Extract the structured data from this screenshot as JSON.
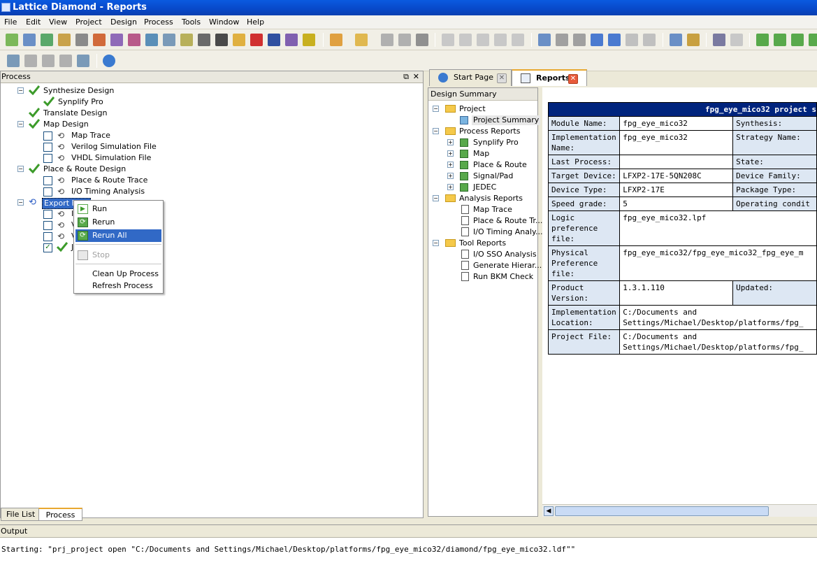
{
  "window": {
    "title": "Lattice Diamond - Reports"
  },
  "menu": [
    "File",
    "Edit",
    "View",
    "Project",
    "Design",
    "Process",
    "Tools",
    "Window",
    "Help"
  ],
  "process_panel": {
    "title": "Process",
    "items": [
      {
        "label": "Synthesize Design"
      },
      {
        "label": "Synplify Pro"
      },
      {
        "label": "Translate Design"
      },
      {
        "label": "Map Design"
      },
      {
        "label": "Map Trace"
      },
      {
        "label": "Verilog Simulation File"
      },
      {
        "label": "VHDL Simulation File"
      },
      {
        "label": "Place & Route Design"
      },
      {
        "label": "Place & Route Trace"
      },
      {
        "label": "I/O Timing Analysis"
      },
      {
        "label": "Export Files"
      },
      {
        "label": "I"
      },
      {
        "label": "V"
      },
      {
        "label": "V"
      },
      {
        "label": "J"
      }
    ]
  },
  "context_menu": {
    "run": "Run",
    "rerun": "Rerun",
    "rerun_all": "Rerun All",
    "stop": "Stop",
    "cleanup": "Clean Up Process",
    "refresh": "Refresh Process"
  },
  "bottom_tabs": {
    "file_list": "File List",
    "process": "Process"
  },
  "tabs": {
    "start_page": "Start Page",
    "reports": "Reports"
  },
  "design_summary": {
    "title": "Design Summary",
    "nodes": [
      "Project",
      "Project Summary",
      "Process Reports",
      "Synplify Pro",
      "Map",
      "Place & Route",
      "Signal/Pad",
      "JEDEC",
      "Analysis Reports",
      "Map Trace",
      "Place & Route Tr...",
      "I/O Timing Analy...",
      "Tool Reports",
      "I/O SSO Analysis",
      "Generate Hierar...",
      "Run BKM Check"
    ]
  },
  "report": {
    "header": "fpg_eye_mico32 project s",
    "rows": [
      {
        "k": "Module Name:",
        "v": "fpg_eye_mico32",
        "k2": "Synthesis:"
      },
      {
        "k": "Implementation Name:",
        "v": "fpg_eye_mico32",
        "k2": "Strategy Name:"
      },
      {
        "k": "Last Process:",
        "v": "",
        "k2": "State:"
      },
      {
        "k": "Target Device:",
        "v": "LFXP2-17E-5QN208C",
        "k2": "Device Family:"
      },
      {
        "k": "Device Type:",
        "v": "LFXP2-17E",
        "k2": "Package Type:"
      },
      {
        "k": "Speed grade:",
        "v": "5",
        "k2": "Operating condit"
      },
      {
        "k": "Logic preference file:",
        "v": "fpg_eye_mico32.lpf"
      },
      {
        "k": "Physical Preference file:",
        "v": "fpg_eye_mico32/fpg_eye_mico32_fpg_eye_m"
      },
      {
        "k": "Product Version:",
        "v": "1.3.1.110",
        "k2": "Updated:"
      },
      {
        "k": "Implementation Location:",
        "v": "C:/Documents and Settings/Michael/Desktop/platforms/fpg_"
      },
      {
        "k": "Project File:",
        "v": "C:/Documents and Settings/Michael/Desktop/platforms/fpg_"
      }
    ]
  },
  "output": {
    "title": "Output",
    "text": "Starting: \"prj_project open \"C:/Documents and Settings/Michael/Desktop/platforms/fpg_eye_mico32/diamond/fpg_eye_mico32.ldf\"\""
  }
}
